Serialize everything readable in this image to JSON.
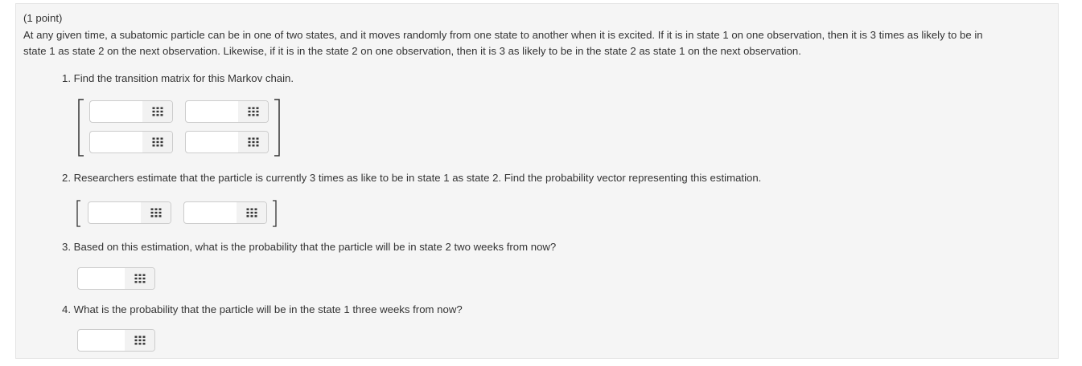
{
  "problem": {
    "points": "(1 point)",
    "intro_line1": "At any given time, a subatomic particle can be in one of two states, and it moves randomly from one state to another when it is excited. If it is in state 1 on one observation, then it is 3 times as likely to be in",
    "intro_line2": "state 1 as state 2 on the next observation. Likewise, if it is in the state 2 on one observation, then it is 3 as likely to be in the state 2 as state 1 on the next observation.",
    "questions": [
      "1. Find the transition matrix for this Markov chain.",
      "2. Researchers estimate that the particle is currently 3 times as like to be in state 1 as state 2. Find the probability vector representing this estimation.",
      "3. Based on this estimation, what is the probability that the particle will be in state 2 two weeks from now?",
      "4. What is the probability that the particle will be in the state 1 three weeks from now?"
    ]
  },
  "answers": {
    "matrix": [
      "",
      "",
      "",
      ""
    ],
    "vector": [
      "",
      ""
    ],
    "q3": "",
    "q4": ""
  },
  "icon": "keypad-grid-icon",
  "colors": {
    "panel_bg": "#f5f5f5",
    "panel_border": "#e3e3e3",
    "input_border": "#cccccc",
    "icon": "#333333"
  }
}
